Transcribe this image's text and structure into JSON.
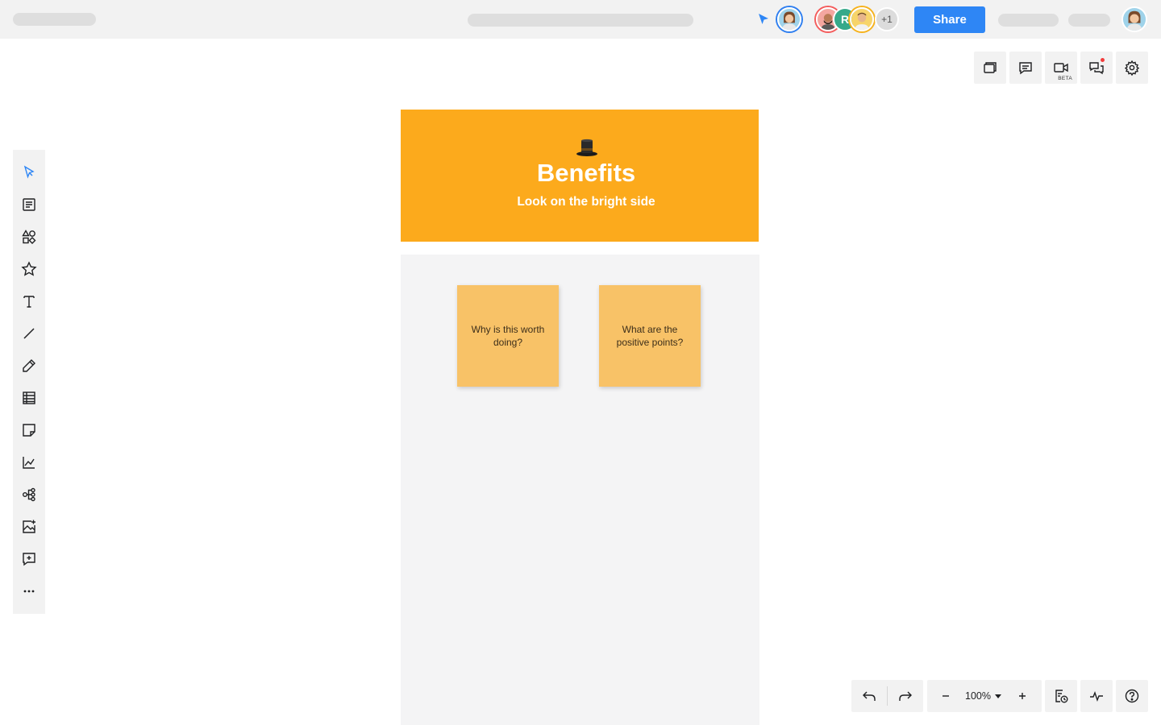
{
  "topbar": {
    "share_label": "Share",
    "extra_collaborators": "+1",
    "collaborator_initial": "R"
  },
  "top_tools": [
    {
      "name": "pages-icon"
    },
    {
      "name": "comments-icon"
    },
    {
      "name": "video-icon",
      "badge": "BETA"
    },
    {
      "name": "chat-icon",
      "notification": true
    },
    {
      "name": "settings-icon"
    }
  ],
  "sidebar_tools": [
    "select-icon",
    "templates-icon",
    "shapes-icon",
    "favorites-icon",
    "text-icon",
    "line-icon",
    "pen-icon",
    "table-icon",
    "sticky-note-icon",
    "chart-icon",
    "mind-map-icon",
    "image-icon",
    "add-comment-icon",
    "more-icon"
  ],
  "board": {
    "title": "Benefits",
    "subtitle": "Look on the bright side",
    "title_icon": "top-hat-icon",
    "header_color": "#fcaa1c",
    "sticky_color": "#f8c267",
    "notes": [
      "Why is this worth doing?",
      "What are the positive points?"
    ]
  },
  "bottom": {
    "zoom": "100%"
  },
  "colors": {
    "accent": "#2e86f5",
    "toolbar_bg": "#f2f2f2"
  }
}
